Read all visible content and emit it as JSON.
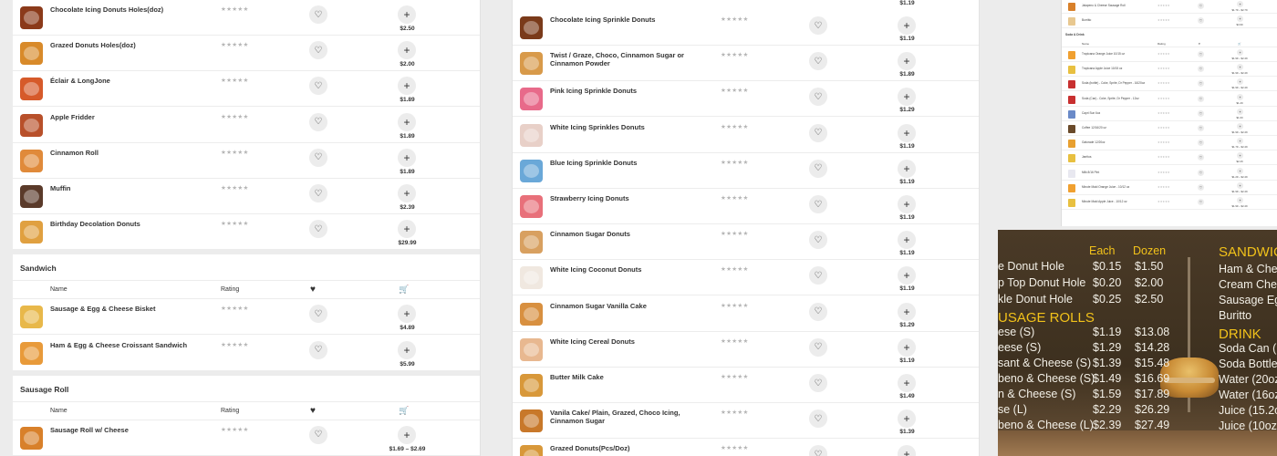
{
  "left_panel": {
    "top_items": [
      {
        "name": "Chocolate Icing Donuts Holes(doz)",
        "price": "$2.50",
        "stars": "★★★★★",
        "color": "#8b3a1a"
      },
      {
        "name": "Grazed Donuts Holes(doz)",
        "price": "$2.00",
        "stars": "★★★★★",
        "color": "#d88a2a"
      },
      {
        "name": "Éclair & LongJone",
        "price": "$1.89",
        "stars": "★★★★★",
        "color": "#d65a2a"
      },
      {
        "name": "Apple Fridder",
        "price": "$1.89",
        "stars": "★★★★★",
        "color": "#b8502a"
      },
      {
        "name": "Cinnamon Roll",
        "price": "$1.89",
        "stars": "★★★★★",
        "color": "#e08a3a"
      },
      {
        "name": "Muffin",
        "price": "$2.39",
        "stars": "★★★★★",
        "color": "#5a3a2a"
      },
      {
        "name": "Birthday Decolation Donuts",
        "price": "$29.99",
        "stars": "★★★★★",
        "color": "#e0a040"
      }
    ],
    "sections": [
      {
        "title": "Sandwich",
        "col_name": "Name",
        "col_rating": "Rating",
        "items": [
          {
            "name": "Sausage & Egg & Cheese Bisket",
            "price": "$4.89",
            "stars": "★★★★★",
            "color": "#e8b84a"
          },
          {
            "name": "Ham & Egg & Cheese Croissant Sandwich",
            "price": "$5.99",
            "stars": "★★★★★",
            "color": "#e89a3a"
          }
        ]
      },
      {
        "title": "Sausage Roll",
        "col_name": "Name",
        "col_rating": "Rating",
        "items": [
          {
            "name": "Sausage Roll w/ Cheese",
            "price": "$1.69 – $2.69",
            "stars": "★★★★★",
            "color": "#d8802a"
          }
        ]
      }
    ]
  },
  "mid_panel": {
    "top_price": "$1.19",
    "items": [
      {
        "name": "Chocolate Icing Sprinkle Donuts",
        "price": "$1.19",
        "stars": "★★★★★",
        "color": "#7a3a1a"
      },
      {
        "name": "Twist / Graze, Choco, Cinnamon Sugar or Cinnamon Powder",
        "price": "$1.89",
        "stars": "★★★★★",
        "color": "#d89a4a"
      },
      {
        "name": "Pink Icing Sprinkle Donuts",
        "price": "$1.29",
        "stars": "★★★★★",
        "color": "#e86a8a"
      },
      {
        "name": "White Icing Sprinkles Donuts",
        "price": "$1.19",
        "stars": "★★★★★",
        "color": "#e8d0c8"
      },
      {
        "name": "Blue Icing Sprinkle Donuts",
        "price": "$1.19",
        "stars": "★★★★★",
        "color": "#6aa8d8"
      },
      {
        "name": "Strawberry Icing Donuts",
        "price": "$1.19",
        "stars": "★★★★★",
        "color": "#e8707a"
      },
      {
        "name": "Cinnamon Sugar Donuts",
        "price": "$1.19",
        "stars": "★★★★★",
        "color": "#d8a060"
      },
      {
        "name": "White Icing Coconut Donuts",
        "price": "$1.19",
        "stars": "★★★★★",
        "color": "#f0e8e0"
      },
      {
        "name": "Cinnamon Sugar Vanilla Cake",
        "price": "$1.29",
        "stars": "★★★★★",
        "color": "#d89040"
      },
      {
        "name": "White Icing Cereal Donuts",
        "price": "$1.19",
        "stars": "★★★★★",
        "color": "#e8b890"
      },
      {
        "name": "Butter Milk Cake",
        "price": "$1.49",
        "stars": "★★★★★",
        "color": "#d8983a"
      },
      {
        "name": "Vanila Cake/ Plain, Grazed, Choco Icing, Cinnamon Sugar",
        "price": "$1.39",
        "stars": "★★★★★",
        "color": "#c8782a"
      },
      {
        "name": "Grazed Donuts(Pcs/Doz)",
        "price": "",
        "stars": "★★★★★",
        "color": "#d8983a"
      }
    ]
  },
  "mini_panel": {
    "top_items": [
      {
        "name": "Jalapeno & Cheese Sausage Roll",
        "price": "$1.79 – $2.79",
        "color": "#d8802a"
      },
      {
        "name": "Burritto",
        "price": "$4.99",
        "color": "#e8c890"
      }
    ],
    "section_title": "Soda & Drink",
    "col_name": "Name",
    "col_rating": "Rating",
    "items": [
      {
        "name": "Tropicana Orange Juice 10/15 oz",
        "price": "$1.99 – $2.49",
        "color": "#f0a030"
      },
      {
        "name": "Tropicana Apple Juice 10/15 oz",
        "price": "$1.99 – $2.49",
        "color": "#e8c040"
      },
      {
        "name": "Soda (bottle) - Coke, Sprite, Dr Pepper - 16/20oz",
        "price": "$1.99 – $2.49",
        "color": "#c83030"
      },
      {
        "name": "Soda (Can) - Coke, Sprite, Dr Pepper - 12oz",
        "price": "$1.29",
        "color": "#c83030"
      },
      {
        "name": "Capri Sun 6oz",
        "price": "$1.00",
        "color": "#6a8ac8"
      },
      {
        "name": "Coffee 12/16/20 oz",
        "price": "$1.99 – $2.49",
        "color": "#6a4a2a"
      },
      {
        "name": "Gatorade 12/20oz",
        "price": "$1.79 – $2.49",
        "color": "#e8a030"
      },
      {
        "name": "Jarritos",
        "price": "$2.29",
        "color": "#e8c040"
      },
      {
        "name": "Milk 8/16 Pint",
        "price": "$1.29 – $2.49",
        "color": "#e8e8f0"
      },
      {
        "name": "Minute Maid Orange Juice - 10/12 oz",
        "price": "$1.99 – $2.49",
        "color": "#f0a030"
      },
      {
        "name": "Minute Maid Apple Juice - 10/12 oz",
        "price": "$1.99 – $2.49",
        "color": "#e8c040"
      }
    ],
    "stars": "★★★★★"
  },
  "menu_board": {
    "col_each": "Each",
    "col_dozen": "Dozen",
    "donut_rows": [
      {
        "name": "e Donut Hole",
        "each": "$0.15",
        "dozen": "$1.50"
      },
      {
        "name": "p Top Donut Hole",
        "each": "$0.20",
        "dozen": "$2.00"
      },
      {
        "name": "kle Donut Hole",
        "each": "$0.25",
        "dozen": "$2.50"
      }
    ],
    "sausage_heading": "USAGE ROLLS",
    "sausage_rows": [
      {
        "name": "ese (S)",
        "each": "$1.19",
        "dozen": "$13.08"
      },
      {
        "name": "eese (S)",
        "each": "$1.29",
        "dozen": "$14.28"
      },
      {
        "name": "sant & Cheese (S)",
        "each": "$1.39",
        "dozen": "$15.48"
      },
      {
        "name": "beno & Cheese (S)",
        "each": "$1.49",
        "dozen": "$16.69"
      },
      {
        "name": "n & Cheese (S)",
        "each": "$1.59",
        "dozen": "$17.89"
      },
      {
        "name": "se (L)",
        "each": "$2.29",
        "dozen": "$26.29"
      },
      {
        "name": "beno & Cheese (L)",
        "each": "$2.39",
        "dozen": "$27.49"
      }
    ],
    "sandwich_heading": "SANDWIC",
    "sandwich_items": [
      "Ham & Chees",
      "Cream Chees",
      "Sausage Egg &",
      "Buritto"
    ],
    "drink_heading": "DRINK",
    "drink_items": [
      "Soda Can (12",
      "Soda Bottle (",
      "Water (20oz)",
      "Water (16oz)",
      "Juice (15.2o",
      "Juice (10oz)"
    ]
  }
}
